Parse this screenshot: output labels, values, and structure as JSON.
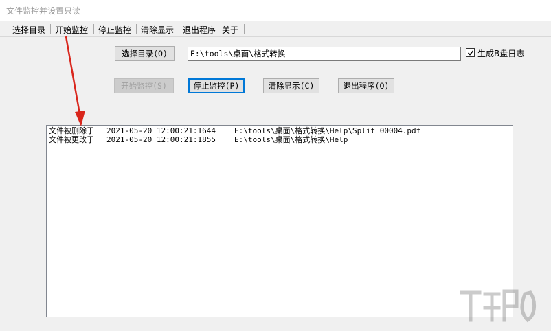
{
  "window": {
    "title": "文件监控并设置只读"
  },
  "menu": {
    "items": [
      {
        "label": "选择目录"
      },
      {
        "label": "开始监控"
      },
      {
        "label": "停止监控"
      },
      {
        "label": "清除显示"
      },
      {
        "label": "退出程序"
      },
      {
        "label": "关于"
      }
    ]
  },
  "controls": {
    "select_dir_button": "选择目录(O)",
    "path_value": "E:\\tools\\桌面\\格式转换",
    "log_checkbox": {
      "label": "生成B盘日志",
      "checked": true
    },
    "start_button": {
      "label": "开始监控(S)",
      "enabled": false
    },
    "stop_button": "停止监控(P)",
    "clear_button": "清除显示(C)",
    "exit_button": "退出程序(Q)"
  },
  "log": {
    "rows": [
      {
        "event": "文件被删除于",
        "time": "2021-05-20 12:00:21:1644",
        "path": "E:\\tools\\桌面\\格式转换\\Help\\Split_00004.pdf"
      },
      {
        "event": "文件被更改于",
        "time": "2021-05-20 12:00:21:1855",
        "path": "E:\\tools\\桌面\\格式转换\\Help"
      }
    ]
  },
  "annotation": {
    "arrow_color": "#d9261c"
  }
}
